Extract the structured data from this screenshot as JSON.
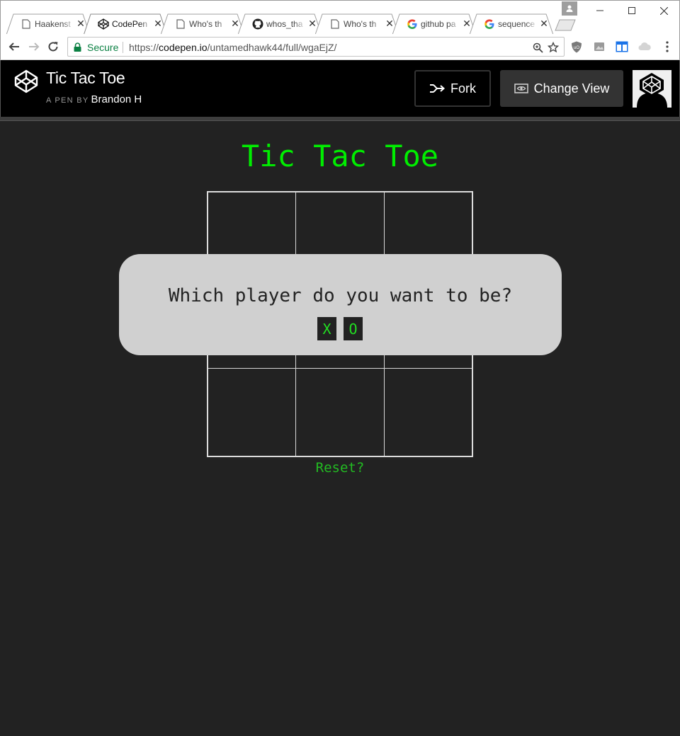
{
  "browser": {
    "tabs": [
      {
        "title": "Haakenst",
        "favicon": "page-icon",
        "active": false
      },
      {
        "title": "CodePen",
        "favicon": "codepen-icon",
        "active": true
      },
      {
        "title": "Who's th",
        "favicon": "page-icon",
        "active": false
      },
      {
        "title": "whos_tha",
        "favicon": "github-icon",
        "active": false
      },
      {
        "title": "Who's th",
        "favicon": "page-icon",
        "active": false
      },
      {
        "title": "github pa",
        "favicon": "google-icon",
        "active": false
      },
      {
        "title": "sequence",
        "favicon": "google-icon",
        "active": false
      }
    ],
    "address": {
      "secure_label": "Secure",
      "scheme": "https://",
      "host": "codepen.io",
      "path": "/untamedhawk44/full/wgaEjZ/"
    },
    "colors": {
      "secure": "#0b8043"
    }
  },
  "header": {
    "title": "Tic Tac Toe",
    "byline_prefix": "A PEN BY",
    "author": "Brandon H",
    "fork_label": "Fork",
    "change_view_label": "Change View"
  },
  "game": {
    "title": "Tic Tac Toe",
    "board": [
      [
        "",
        "",
        ""
      ],
      [
        "",
        "",
        ""
      ],
      [
        "",
        "",
        ""
      ]
    ],
    "reset_label": "Reset?",
    "modal": {
      "question": "Which player do you want to be?",
      "choices": [
        "X",
        "O"
      ]
    },
    "colors": {
      "accent": "#00ee00",
      "background": "#222222",
      "modal": "#d0d0d0"
    }
  }
}
